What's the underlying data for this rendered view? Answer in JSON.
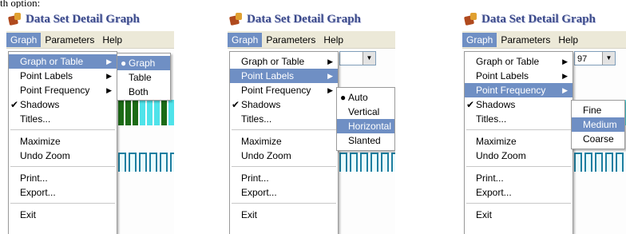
{
  "caption": "th option:",
  "window_title": "Data Set Detail Graph",
  "menubar": {
    "items": [
      "Graph",
      "Parameters",
      "Help"
    ]
  },
  "graph_menu": {
    "graph_or_table": "Graph or Table",
    "point_labels": "Point Labels",
    "point_frequency": "Point Frequency",
    "shadows": "Shadows",
    "titles": "Titles...",
    "maximize": "Maximize",
    "undo_zoom": "Undo Zoom",
    "print": "Print...",
    "export": "Export...",
    "exit": "Exit",
    "check_mark": "✔",
    "submenu_arrow": "▶"
  },
  "submenus": {
    "graph_or_table": {
      "items": [
        "Graph",
        "Table",
        "Both"
      ],
      "selected": "Graph",
      "highlighted": ""
    },
    "point_labels": {
      "items": [
        "Auto",
        "Vertical",
        "Horizontal",
        "Slanted"
      ],
      "selected": "Auto",
      "highlighted": "Horizontal"
    },
    "point_frequency": {
      "items": [
        "Fine",
        "Medium",
        "Coarse"
      ],
      "selected": "",
      "highlighted": "Medium"
    }
  },
  "combo_value": "97",
  "bullet": "●",
  "colors": {
    "highlight": "#6f8fc4",
    "menubar": "#ece9d8",
    "title_text": "#3b4a8a",
    "bar_green": "#1c6b16",
    "bar_cyan": "#4fe3ea"
  }
}
